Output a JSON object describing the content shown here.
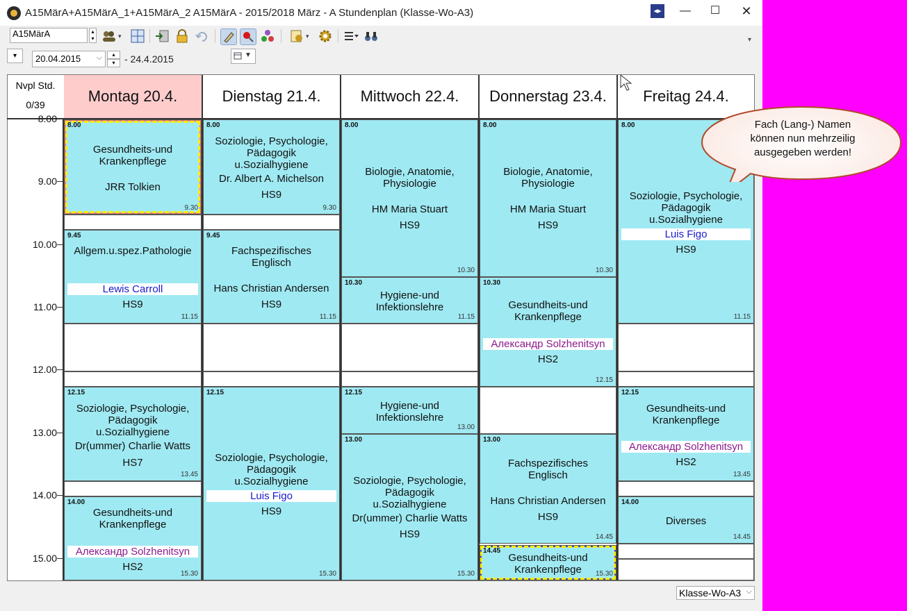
{
  "window": {
    "title": "A15MärA+A15MärA_1+A15MärA_2 A15MärA - 2015/2018 März - A  Stundenplan  (Klasse-Wo-A3)",
    "minimize": "—",
    "maximize": "☐",
    "close": "✕",
    "split": "◂▸"
  },
  "toolbar": {
    "class_select_value": "A15MärA",
    "overflow": "▾"
  },
  "datebar": {
    "menu": "▾",
    "date_from": "20.04.2015",
    "date_to": "- 24.4.2015",
    "spin_up": "▴",
    "spin_down": "▾"
  },
  "grid": {
    "corner_label": "Nvpl Std.",
    "corner_count": "0/39",
    "days": [
      "Montag 20.4.",
      "Dienstag 21.4.",
      "Mittwoch 22.4.",
      "Donnerstag 23.4.",
      "Freitag 24.4."
    ],
    "times": [
      "8.00",
      "9.00",
      "10.00",
      "11.00",
      "12.00",
      "13.00",
      "14.00",
      "15.00"
    ]
  },
  "lessons": {
    "mo1": {
      "start": "8.00",
      "end": "9.30",
      "subject": [
        "Gesundheits-und",
        "Krankenpflege"
      ],
      "teacher": "JRR Tolkien"
    },
    "mo2": {
      "start": "9.45",
      "end": "11.15",
      "subject": [
        "Allgem.u.spez.Pathologie"
      ],
      "teacher": "Lewis Carroll",
      "room": "HS9"
    },
    "mo3": {
      "start": "12.15",
      "end": "13.45",
      "subject": [
        "Soziologie, Psychologie,",
        "Pädagogik",
        "u.Sozialhygiene"
      ],
      "teacher": "Dr(ummer) Charlie Watts",
      "room": "HS7"
    },
    "mo4": {
      "start": "14.00",
      "end": "15.30",
      "subject": [
        "Gesundheits-und",
        "Krankenpflege"
      ],
      "teacher": "Александр Solzhenitsyn",
      "room": "HS2"
    },
    "di1": {
      "start": "8.00",
      "end": "9.30",
      "subject": [
        "Soziologie, Psychologie,",
        "Pädagogik",
        "u.Sozialhygiene"
      ],
      "teacher": "Dr. Albert A. Michelson",
      "room": "HS9"
    },
    "di2": {
      "start": "9.45",
      "end": "11.15",
      "subject": [
        "Fachspezifisches",
        "Englisch"
      ],
      "teacher": "Hans Christian Andersen",
      "room": "HS9"
    },
    "di3": {
      "start": "12.15",
      "end": "15.30",
      "subject": [
        "Soziologie, Psychologie,",
        "Pädagogik",
        "u.Sozialhygiene"
      ],
      "teacher": "Luis Figo",
      "room": "HS9"
    },
    "mi1": {
      "start": "8.00",
      "end": "10.30",
      "subject": [
        "Biologie, Anatomie,",
        "Physiologie"
      ],
      "teacher": "HM Maria Stuart",
      "room": "HS9"
    },
    "mi2": {
      "start": "10.30",
      "end": "11.15",
      "subject": [
        "Hygiene-und",
        "Infektionslehre"
      ]
    },
    "mi3": {
      "start": "12.15",
      "end": "13.00",
      "subject": [
        "Hygiene-und",
        "Infektionslehre"
      ]
    },
    "mi4": {
      "start": "13.00",
      "end": "15.30",
      "subject": [
        "Soziologie, Psychologie,",
        "Pädagogik",
        "u.Sozialhygiene"
      ],
      "teacher": "Dr(ummer) Charlie Watts",
      "room": "HS9"
    },
    "do1": {
      "start": "8.00",
      "end": "10.30",
      "subject": [
        "Biologie, Anatomie,",
        "Physiologie"
      ],
      "teacher": "HM Maria Stuart",
      "room": "HS9"
    },
    "do2": {
      "start": "10.30",
      "end": "12.15",
      "subject": [
        "Gesundheits-und",
        "Krankenpflege"
      ],
      "teacher": "Александр Solzhenitsyn",
      "room": "HS2"
    },
    "do3": {
      "start": "13.00",
      "end": "14.45",
      "subject": [
        "Fachspezifisches",
        "Englisch"
      ],
      "teacher": "Hans Christian Andersen",
      "room": "HS9"
    },
    "do4": {
      "start": "14.45",
      "end": "15.30",
      "subject": [
        "Gesundheits-und",
        "Krankenpflege"
      ]
    },
    "fr1": {
      "start": "8.00",
      "end": "11.15",
      "subject": [
        "Soziologie, Psychologie,",
        "Pädagogik",
        "u.Sozialhygiene"
      ],
      "teacher": "Luis Figo",
      "room": "HS9"
    },
    "fr2": {
      "start": "12.15",
      "end": "13.45",
      "subject": [
        "Gesundheits-und",
        "Krankenpflege"
      ],
      "teacher": "Александр Solzhenitsyn",
      "room": "HS2"
    },
    "fr3": {
      "start": "14.00",
      "end": "14.45",
      "subject": [
        "Diverses"
      ]
    }
  },
  "callout": {
    "lines": [
      "Fach (Lang-) Namen",
      "können nun mehrzeilig",
      "ausgegeben werden!"
    ]
  },
  "status": {
    "view_select_value": "Klasse-Wo-A3"
  },
  "colors": {
    "lesson_bg": "#9fe9f2",
    "today_header": "#ffcccc",
    "teacher_blue": "#1a1acc",
    "teacher_purple": "#8b1a8b",
    "desktop_bg": "#ff00ff",
    "selection_dash": "#ffee00"
  }
}
